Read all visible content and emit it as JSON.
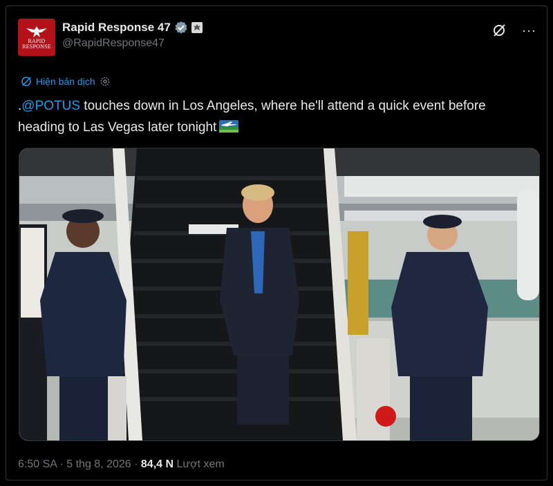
{
  "account": {
    "display_name": "Rapid Response 47",
    "handle": "@RapidResponse47",
    "avatar_text": "RAPID RESPONSE"
  },
  "translate": {
    "label": "Hiện bản dịch"
  },
  "tweet": {
    "prefix": ".",
    "mention": "@POTUS",
    "text": " touches down in Los Angeles, where he'll attend a quick event before heading to Las Vegas later tonight"
  },
  "meta": {
    "time": "6:50 SA",
    "sep1": " · ",
    "date": "5 thg 8, 2026",
    "sep2": " · ",
    "views": "84,4 N",
    "views_label": " Lượt xem"
  },
  "colors": {
    "accent": "#1d9bf0",
    "secondary": "#71767b",
    "text": "#e7e9ea",
    "avatar_bg": "#b3121b"
  },
  "icons": [
    "verified-badge-icon",
    "government-badge-icon",
    "grok-icon",
    "more-icon",
    "translate-icon",
    "settings-icon",
    "airplane-flag-icon"
  ]
}
